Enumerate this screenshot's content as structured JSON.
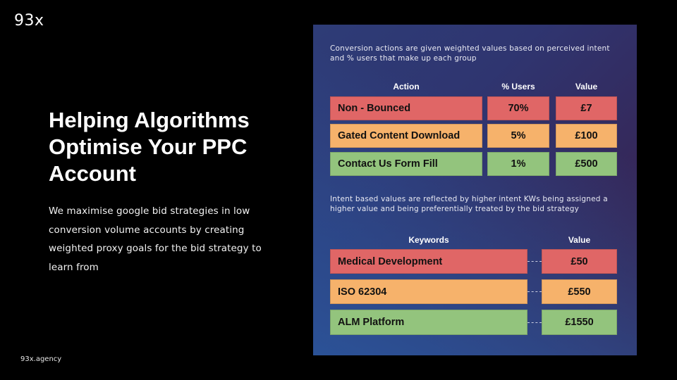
{
  "brand": {
    "logo": "93x",
    "footer": "93x.agency"
  },
  "hero": {
    "title": "Helping Algorithms Optimise Your PPC Account",
    "description": "We maximise google bid strategies in low conversion volume accounts by creating weighted proxy goals for the bid strategy to learn from"
  },
  "panel": {
    "intro": "Conversion actions are given weighted values based on perceived intent and % users that make up each group",
    "actions_table": {
      "headers": [
        "Action",
        "% Users",
        "Value"
      ],
      "rows": [
        {
          "action": "Non - Bounced",
          "users": "70%",
          "value": "£7",
          "color": "#e06666"
        },
        {
          "action": "Gated Content Download",
          "users": "5%",
          "value": "£100",
          "color": "#f6b26b"
        },
        {
          "action": "Contact Us Form Fill",
          "users": "1%",
          "value": "£500",
          "color": "#93c47d"
        }
      ]
    },
    "intent_text": "Intent based values are reflected by higher intent KWs being assigned a higher value and being preferentially treated by the bid strategy",
    "keywords_table": {
      "headers": [
        "Keywords",
        "Value"
      ],
      "rows": [
        {
          "keyword": "Medical Development",
          "value": "£50",
          "color": "#e06666"
        },
        {
          "keyword": "ISO 62304",
          "value": "£550",
          "color": "#f6b26b"
        },
        {
          "keyword": "ALM Platform",
          "value": "£1550",
          "color": "#93c47d"
        }
      ]
    }
  }
}
